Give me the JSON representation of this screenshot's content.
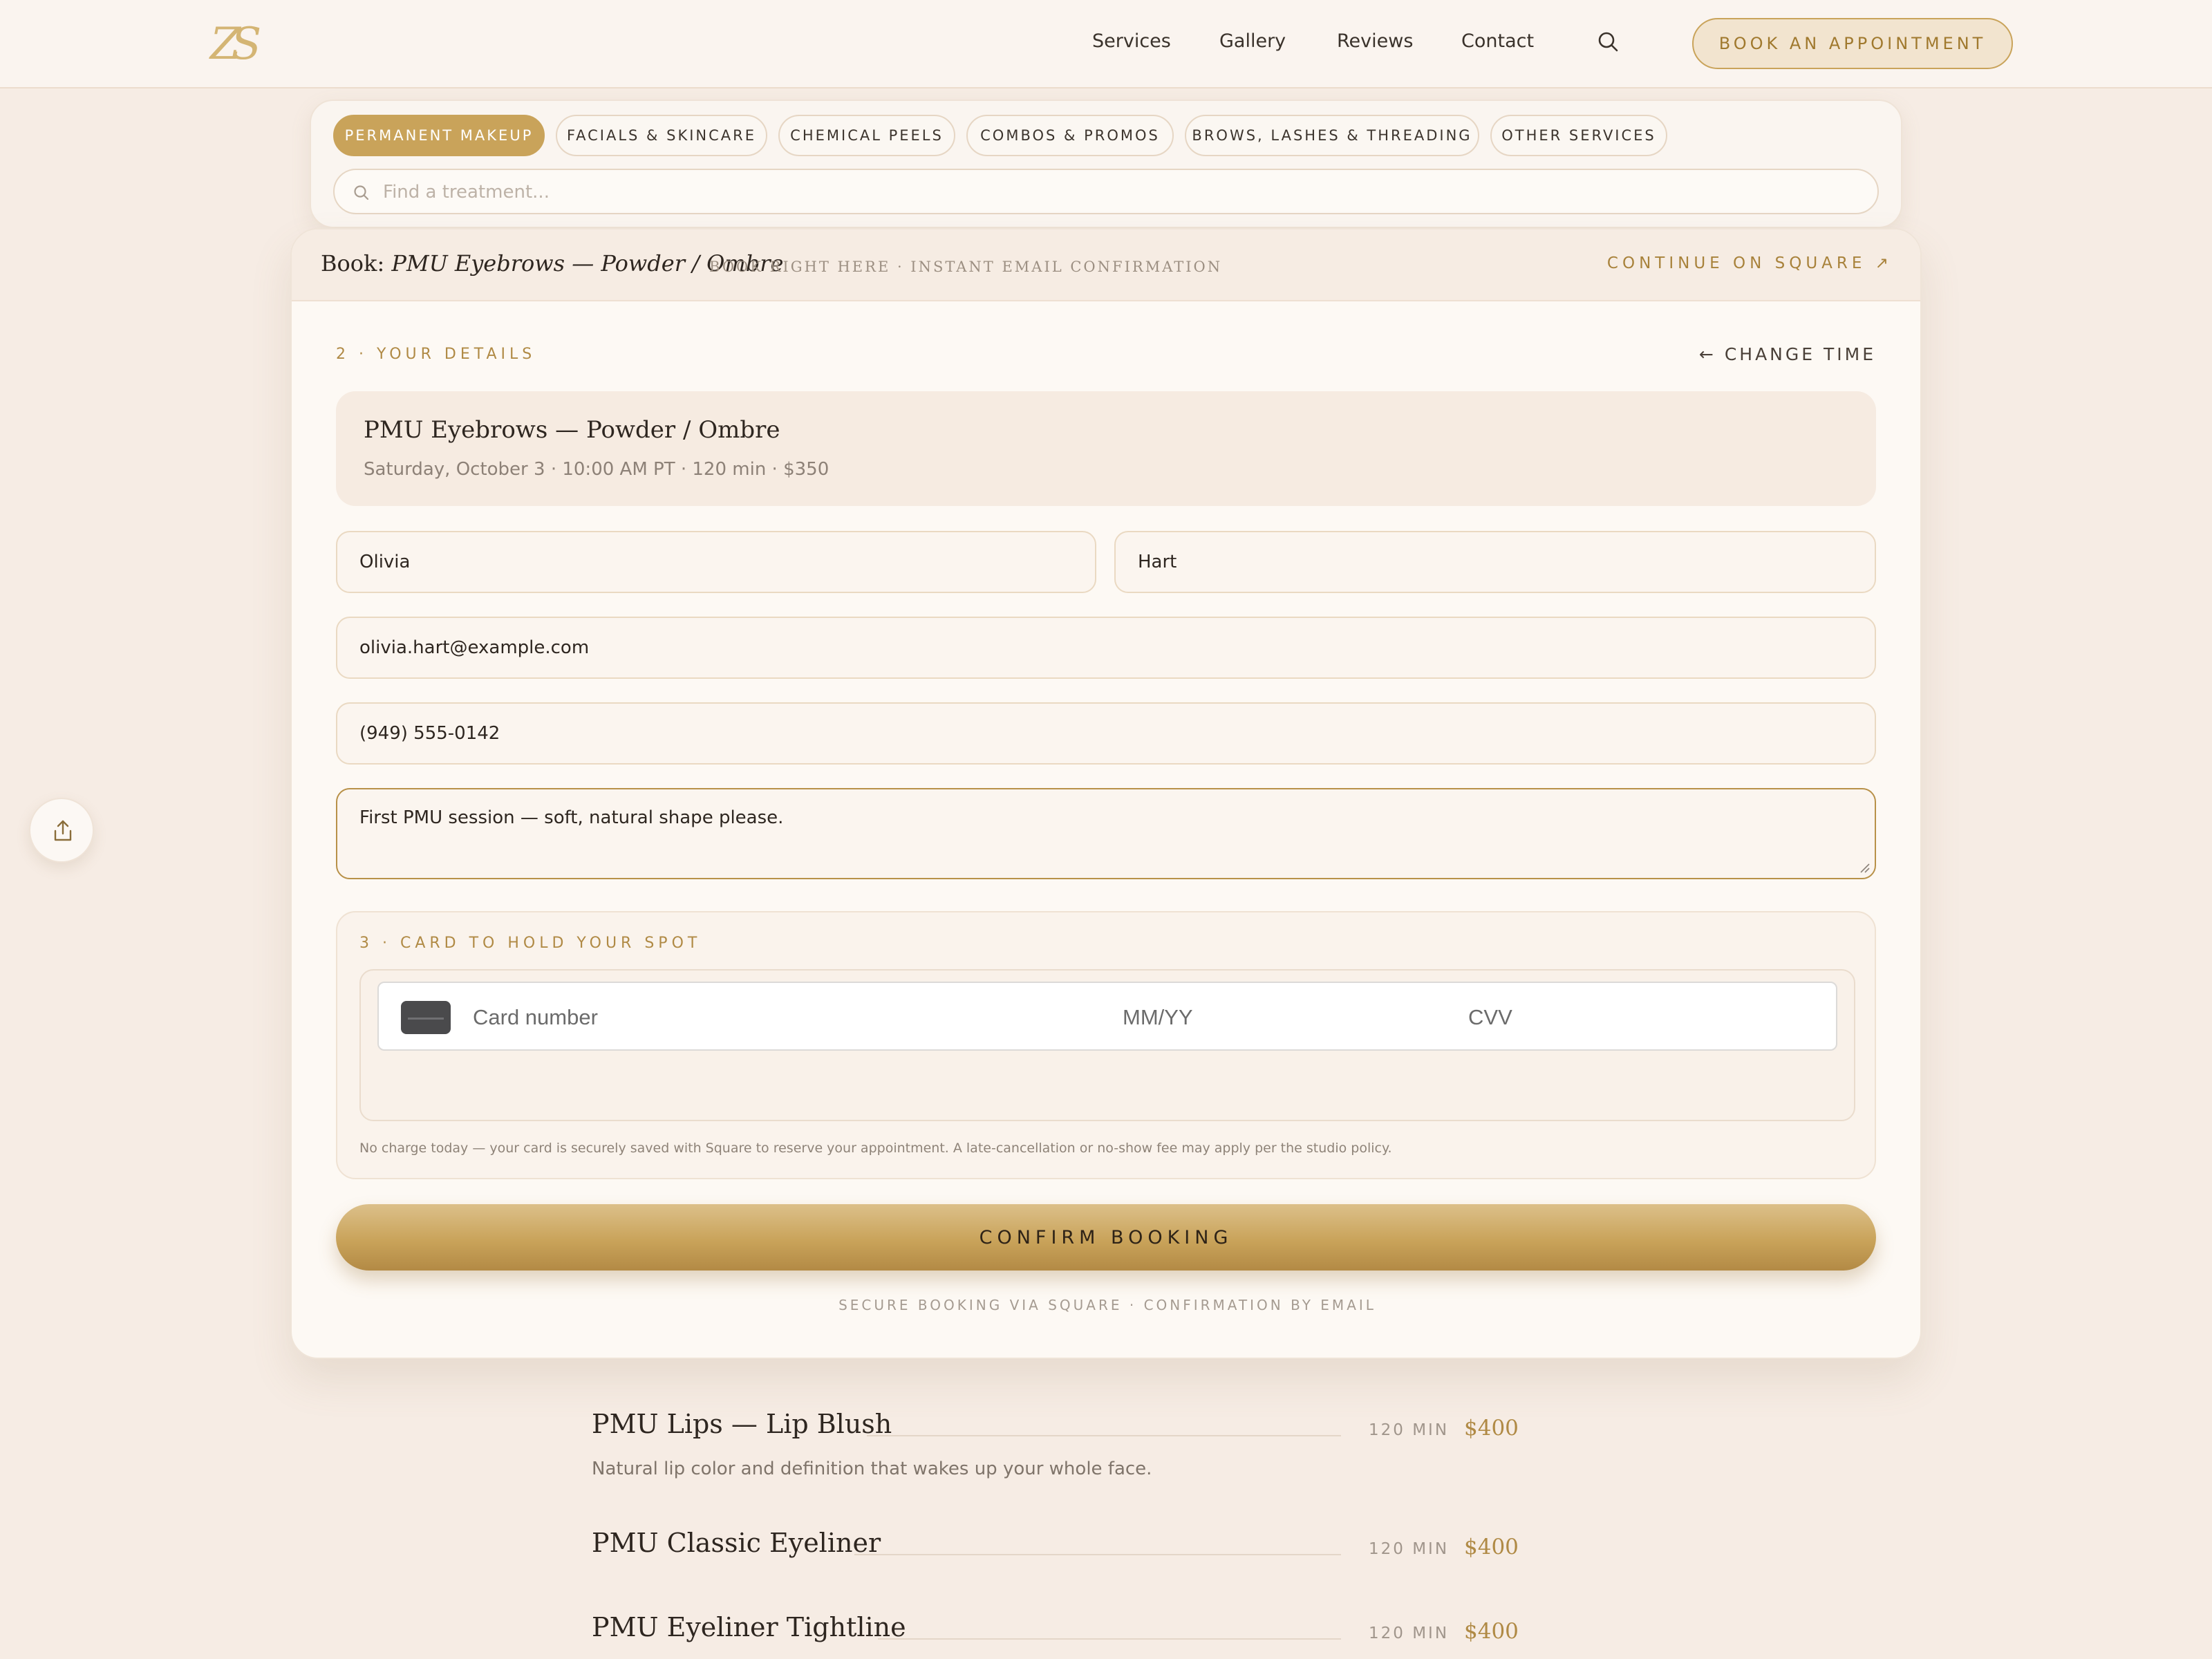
{
  "nav": {
    "logo_text": "ZS",
    "links": [
      "Services",
      "Gallery",
      "Reviews",
      "Contact"
    ],
    "book_label": "BOOK AN APPOINTMENT"
  },
  "categories": {
    "pills": [
      "PERMANENT MAKEUP",
      "FACIALS & SKINCARE",
      "CHEMICAL PEELS",
      "COMBOS & PROMOS",
      "BROWS, LASHES & THREADING",
      "OTHER SERVICES"
    ],
    "active": "PERMANENT MAKEUP",
    "search_placeholder": "Find a treatment..."
  },
  "booking": {
    "title_prefix": "Book:",
    "title_service": "PMU Eyebrows — Powder / Ombre",
    "subtitle": "BOOK RIGHT HERE · INSTANT EMAIL CONFIRMATION",
    "continue_label": "CONTINUE ON SQUARE ↗",
    "step2_label": "2 · YOUR DETAILS",
    "change_time_label": "← CHANGE TIME",
    "summary_title": "PMU Eyebrows — Powder / Ombre",
    "summary_meta": "Saturday, October 3 · 10:00 AM PT · 120 min · $350",
    "first_name": "Olivia",
    "last_name": "Hart",
    "email": "olivia.hart@example.com",
    "phone": "(949) 555-0142",
    "notes": "First PMU session — soft, natural shape please.",
    "step3_label": "3 · CARD TO HOLD YOUR SPOT",
    "card_number_placeholder": "Card number",
    "card_exp_placeholder": "MM/YY",
    "card_cvv_placeholder": "CVV",
    "disclaimer": "No charge today — your card is securely saved with Square to reserve your appointment. A late-cancellation or no-show fee may apply per the studio policy.",
    "confirm_label": "CONFIRM BOOKING",
    "secure_note": "SECURE BOOKING VIA SQUARE · CONFIRMATION BY EMAIL"
  },
  "services": [
    {
      "name": "PMU Lips — Lip Blush",
      "duration": "120 MIN",
      "price": "$400",
      "description": "Natural lip color and definition that wakes up your whole face."
    },
    {
      "name": "PMU Classic Eyeliner",
      "duration": "120 MIN",
      "price": "$400",
      "description": ""
    },
    {
      "name": "PMU Eyeliner Tightline",
      "duration": "120 MIN",
      "price": "$400",
      "description": ""
    }
  ],
  "colors": {
    "accent_gold": "#c9a35a",
    "background": "#f6ece4",
    "card": "#fdf9f4"
  }
}
